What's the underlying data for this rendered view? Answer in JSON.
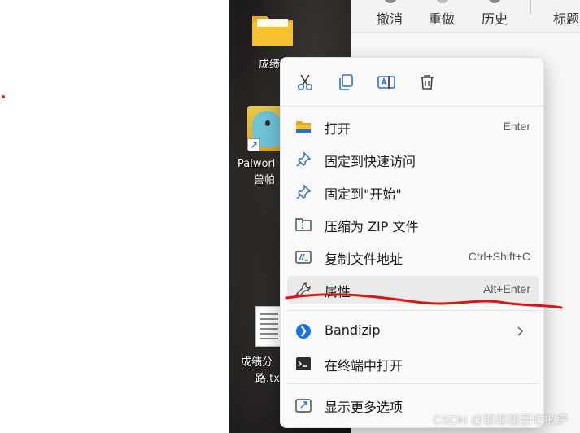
{
  "toolbar": {
    "undo": "撤消",
    "redo": "重做",
    "history": "历史",
    "heading": "标题"
  },
  "desktop": {
    "folder_label": "成绩",
    "palworld_label_line1": "Palworl",
    "palworld_label_line2": "兽帕",
    "txt_label_line1": "成绩分",
    "txt_label_line2": "路.tx"
  },
  "context_menu": {
    "top_icons": [
      "cut-icon",
      "copy-icon",
      "rename-icon",
      "delete-icon"
    ],
    "items": [
      {
        "label": "打开",
        "shortcut": "Enter",
        "icon": "folder-icon"
      },
      {
        "label": "固定到快速访问",
        "shortcut": "",
        "icon": "pin-icon"
      },
      {
        "label": "固定到\"开始\"",
        "shortcut": "",
        "icon": "pin-icon"
      },
      {
        "label": "压缩为 ZIP 文件",
        "shortcut": "",
        "icon": "zip-folder-icon"
      },
      {
        "label": "复制文件地址",
        "shortcut": "Ctrl+Shift+C",
        "icon": "copy-path-icon"
      },
      {
        "label": "属性",
        "shortcut": "Alt+Enter",
        "icon": "wrench-icon"
      },
      {
        "label": "Bandizip",
        "shortcut": "",
        "icon": "bandizip-icon"
      },
      {
        "label": "在终端中打开",
        "shortcut": "",
        "icon": "terminal-icon"
      },
      {
        "label": "显示更多选项",
        "shortcut": "",
        "icon": "more-options-icon"
      }
    ]
  },
  "colors": {
    "annotation_red": "#e01414",
    "accent_blue": "#1a73d9",
    "folder_yellow": "#f5c12e"
  },
  "watermark": "CSDN @耶耶想要吃披萨"
}
